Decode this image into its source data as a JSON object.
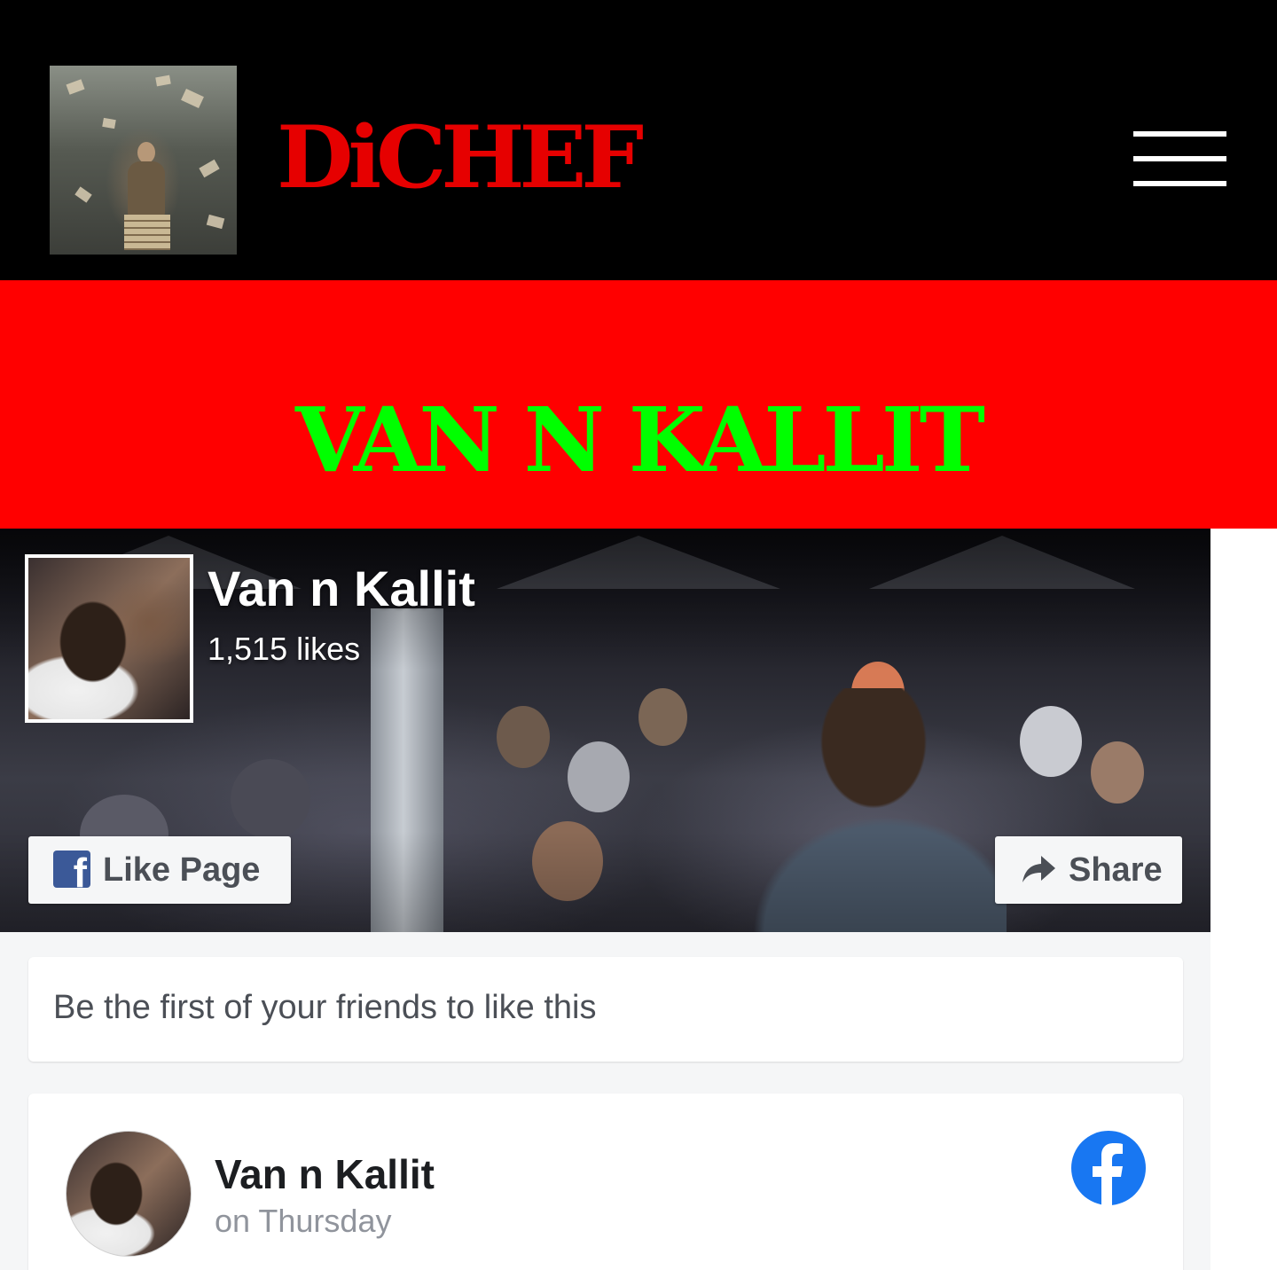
{
  "site": {
    "brand": "DiCHEF",
    "menu_icon": "hamburger-menu-icon",
    "colors": {
      "header_bg": "#000000",
      "brand": "#e60000",
      "banner_bg": "#ff0000",
      "banner_text": "#00ff00"
    }
  },
  "banner": {
    "title": "VAN N KALLIT"
  },
  "facebook_widget": {
    "page_name": "Van n Kallit",
    "likes": "1,515 likes",
    "like_button": "Like Page",
    "share_button": "Share",
    "friends_text": "Be the first of your friends to like this",
    "post": {
      "author": "Van n Kallit",
      "time": "on Thursday"
    },
    "colors": {
      "fb_blue": "#1877f2",
      "fb_classic_blue": "#3b5998",
      "button_text": "#4b4f56"
    }
  }
}
